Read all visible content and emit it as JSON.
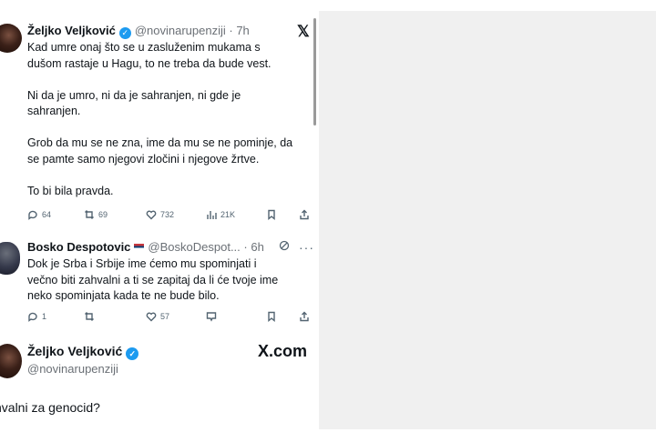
{
  "tweet1": {
    "author_name": "Željko Veljković",
    "handle": "@novinarupenziji",
    "time": "· 7h",
    "brand_icon": "x-logo",
    "lines": [
      "Kad umre onaj što se u zasluženim mukama s",
      "dušom rastaje u Hagu, to ne treba da bude vest.",
      "Ni da je umro, ni da je sahranjen, ni gde je",
      "sahranjen.",
      "Grob da mu se ne zna, ime da mu se ne pominje, da",
      "se pamte samo njegovi zločini i njegove žrtve.",
      "To bi bila pravda."
    ],
    "actions": {
      "replies": "64",
      "reposts": "69",
      "likes": "732",
      "views": "21K"
    }
  },
  "reply": {
    "author_name": "Bosko Despotovic",
    "handle": "@BoskoDespot...",
    "time": "· 6h",
    "lines": [
      "Dok je Srba i Srbije ime ćemo mu spominjati i",
      "večno biti zahvalni a ti se zapitaj da li će tvoje ime",
      "neko spominjata kada te ne bude bilo."
    ],
    "actions": {
      "replies": "1",
      "likes": "57"
    }
  },
  "quote": {
    "author_name": "Željko Veljković",
    "handle": "@novinarupenziji",
    "source": "X.com",
    "text": "hvalni za genocid?"
  },
  "colors": {
    "verified": "#1d9bf0",
    "secondary_text": "#536471",
    "right_pane": "#f0f0f0"
  }
}
